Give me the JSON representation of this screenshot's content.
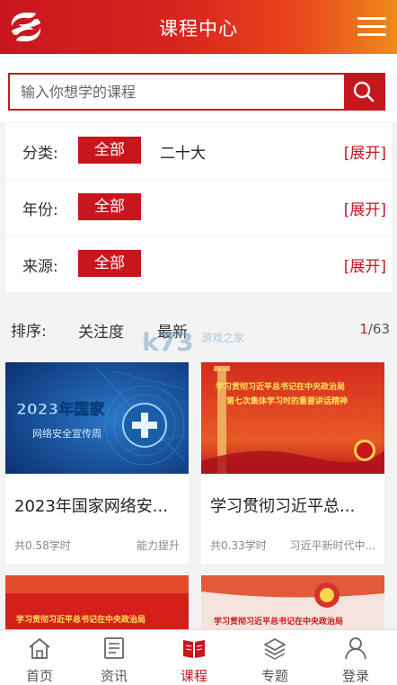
{
  "header": {
    "title": "课程中心"
  },
  "search": {
    "placeholder": "输入你想学的课程"
  },
  "filters": [
    {
      "label": "分类:",
      "selected": "全部",
      "option": "二十大",
      "expand": "[展开]"
    },
    {
      "label": "年份:",
      "selected": "全部",
      "expand": "[展开]"
    },
    {
      "label": "来源:",
      "selected": "全部",
      "expand": "[展开]"
    }
  ],
  "sort": {
    "label": "排序:",
    "options": [
      "关注度",
      "最新"
    ],
    "page_current": "1",
    "page_total": "/63"
  },
  "watermark": {
    "text": "k73",
    "sub": "游戏之家"
  },
  "courses": [
    {
      "title": "2023年国家网络安...",
      "hours": "共0.58学时",
      "tag": "能力提升",
      "banner_line1": "2023年国家",
      "banner_line2": "网络安全宣传周"
    },
    {
      "title": "学习贯彻习近平总...",
      "hours": "共0.33学时",
      "tag": "习近平新时代中...",
      "banner_line1": "学习贯彻习近平总书记在中央政治局",
      "banner_line2": "第七次集体学习时的重要讲话精神"
    }
  ],
  "partial_cards": [
    {
      "banner": "学习贯彻习近平总书记在中央政治局"
    },
    {
      "banner": "学习贯彻习近平总书记在中央政治局"
    }
  ],
  "nav": [
    {
      "label": "首页",
      "icon": "home-icon"
    },
    {
      "label": "资讯",
      "icon": "news-icon"
    },
    {
      "label": "课程",
      "icon": "book-icon",
      "active": true
    },
    {
      "label": "专题",
      "icon": "layers-icon"
    },
    {
      "label": "登录",
      "icon": "user-icon"
    }
  ],
  "colors": {
    "brand_red": "#c8161d",
    "header_orange": "#f08a1c"
  }
}
